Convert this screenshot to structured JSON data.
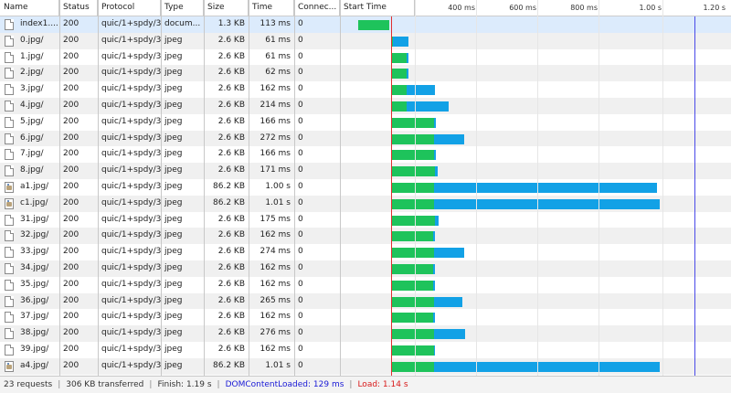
{
  "header": {
    "columns": [
      "Name",
      "Status",
      "Protocol",
      "Type",
      "Size",
      "Time",
      "Connec...",
      "Start Time"
    ],
    "ticks": [
      "400 ms",
      "600 ms",
      "800 ms",
      "1.00 s",
      "1.20 s"
    ]
  },
  "timeline": {
    "max_ms": 1200,
    "dom_content_loaded_ms": 0,
    "load_ms": 1140
  },
  "rows": [
    {
      "name": "index1....",
      "status": "200",
      "protocol": "quic/1+spdy/3",
      "type": "docum...",
      "size": "1.3 KB",
      "time": "113 ms",
      "connection": "0",
      "icon": "document",
      "waiting": [
        -126,
        -9
      ],
      "receiving": null
    },
    {
      "name": "0.jpg/",
      "status": "200",
      "protocol": "quic/1+spdy/3",
      "type": "jpeg",
      "size": "2.6 KB",
      "time": "61 ms",
      "connection": "0",
      "icon": "image-file",
      "waiting": [
        0,
        3
      ],
      "receiving": [
        3,
        61
      ]
    },
    {
      "name": "1.jpg/",
      "status": "200",
      "protocol": "quic/1+spdy/3",
      "type": "jpeg",
      "size": "2.6 KB",
      "time": "61 ms",
      "connection": "0",
      "icon": "image-file",
      "waiting": [
        0,
        56
      ],
      "receiving": [
        56,
        61
      ]
    },
    {
      "name": "2.jpg/",
      "status": "200",
      "protocol": "quic/1+spdy/3",
      "type": "jpeg",
      "size": "2.6 KB",
      "time": "62 ms",
      "connection": "0",
      "icon": "image-file",
      "waiting": [
        0,
        56
      ],
      "receiving": [
        56,
        62
      ]
    },
    {
      "name": "3.jpg/",
      "status": "200",
      "protocol": "quic/1+spdy/3",
      "type": "jpeg",
      "size": "2.6 KB",
      "time": "162 ms",
      "connection": "0",
      "icon": "image-file",
      "waiting": [
        0,
        56
      ],
      "receiving": [
        56,
        162
      ]
    },
    {
      "name": "4.jpg/",
      "status": "200",
      "protocol": "quic/1+spdy/3",
      "type": "jpeg",
      "size": "2.6 KB",
      "time": "214 ms",
      "connection": "0",
      "icon": "image-file",
      "waiting": [
        0,
        56
      ],
      "receiving": [
        56,
        214
      ]
    },
    {
      "name": "5.jpg/",
      "status": "200",
      "protocol": "quic/1+spdy/3",
      "type": "jpeg",
      "size": "2.6 KB",
      "time": "166 ms",
      "connection": "0",
      "icon": "image-file",
      "waiting": [
        0,
        160
      ],
      "receiving": [
        160,
        166
      ]
    },
    {
      "name": "6.jpg/",
      "status": "200",
      "protocol": "quic/1+spdy/3",
      "type": "jpeg",
      "size": "2.6 KB",
      "time": "272 ms",
      "connection": "0",
      "icon": "image-file",
      "waiting": [
        0,
        160
      ],
      "receiving": [
        160,
        272
      ]
    },
    {
      "name": "7.jpg/",
      "status": "200",
      "protocol": "quic/1+spdy/3",
      "type": "jpeg",
      "size": "2.6 KB",
      "time": "166 ms",
      "connection": "0",
      "icon": "image-file",
      "waiting": [
        0,
        160
      ],
      "receiving": [
        160,
        166
      ]
    },
    {
      "name": "8.jpg/",
      "status": "200",
      "protocol": "quic/1+spdy/3",
      "type": "jpeg",
      "size": "2.6 KB",
      "time": "171 ms",
      "connection": "0",
      "icon": "image-file",
      "waiting": [
        0,
        163
      ],
      "receiving": [
        163,
        171
      ]
    },
    {
      "name": "a1.jpg/",
      "status": "200",
      "protocol": "quic/1+spdy/3",
      "type": "jpeg",
      "size": "86.2 KB",
      "time": "1.00 s",
      "connection": "0",
      "icon": "image-photo",
      "waiting": [
        0,
        160
      ],
      "receiving": [
        160,
        1000
      ]
    },
    {
      "name": "c1.jpg/",
      "status": "200",
      "protocol": "quic/1+spdy/3",
      "type": "jpeg",
      "size": "86.2 KB",
      "time": "1.01 s",
      "connection": "0",
      "icon": "image-photo",
      "waiting": [
        0,
        160
      ],
      "receiving": [
        160,
        1010
      ]
    },
    {
      "name": "31.jpg/",
      "status": "200",
      "protocol": "quic/1+spdy/3",
      "type": "jpeg",
      "size": "2.6 KB",
      "time": "175 ms",
      "connection": "0",
      "icon": "image-file",
      "waiting": [
        0,
        163
      ],
      "receiving": [
        163,
        175
      ]
    },
    {
      "name": "32.jpg/",
      "status": "200",
      "protocol": "quic/1+spdy/3",
      "type": "jpeg",
      "size": "2.6 KB",
      "time": "162 ms",
      "connection": "0",
      "icon": "image-file",
      "waiting": [
        0,
        156
      ],
      "receiving": [
        156,
        162
      ]
    },
    {
      "name": "33.jpg/",
      "status": "200",
      "protocol": "quic/1+spdy/3",
      "type": "jpeg",
      "size": "2.6 KB",
      "time": "274 ms",
      "connection": "0",
      "icon": "image-file",
      "waiting": [
        0,
        160
      ],
      "receiving": [
        160,
        274
      ]
    },
    {
      "name": "34.jpg/",
      "status": "200",
      "protocol": "quic/1+spdy/3",
      "type": "jpeg",
      "size": "2.6 KB",
      "time": "162 ms",
      "connection": "0",
      "icon": "image-file",
      "waiting": [
        0,
        156
      ],
      "receiving": [
        156,
        162
      ]
    },
    {
      "name": "35.jpg/",
      "status": "200",
      "protocol": "quic/1+spdy/3",
      "type": "jpeg",
      "size": "2.6 KB",
      "time": "162 ms",
      "connection": "0",
      "icon": "image-file",
      "waiting": [
        0,
        156
      ],
      "receiving": [
        156,
        162
      ]
    },
    {
      "name": "36.jpg/",
      "status": "200",
      "protocol": "quic/1+spdy/3",
      "type": "jpeg",
      "size": "2.6 KB",
      "time": "265 ms",
      "connection": "0",
      "icon": "image-file",
      "waiting": [
        0,
        160
      ],
      "receiving": [
        160,
        265
      ]
    },
    {
      "name": "37.jpg/",
      "status": "200",
      "protocol": "quic/1+spdy/3",
      "type": "jpeg",
      "size": "2.6 KB",
      "time": "162 ms",
      "connection": "0",
      "icon": "image-file",
      "waiting": [
        0,
        156
      ],
      "receiving": [
        156,
        162
      ]
    },
    {
      "name": "38.jpg/",
      "status": "200",
      "protocol": "quic/1+spdy/3",
      "type": "jpeg",
      "size": "2.6 KB",
      "time": "276 ms",
      "connection": "0",
      "icon": "image-file",
      "waiting": [
        0,
        160
      ],
      "receiving": [
        160,
        276
      ]
    },
    {
      "name": "39.jpg/",
      "status": "200",
      "protocol": "quic/1+spdy/3",
      "type": "jpeg",
      "size": "2.6 KB",
      "time": "162 ms",
      "connection": "0",
      "icon": "image-file",
      "waiting": [
        0,
        160
      ],
      "receiving": [
        160,
        162
      ]
    },
    {
      "name": "a4.jpg/",
      "status": "200",
      "protocol": "quic/1+spdy/3",
      "type": "jpeg",
      "size": "86.2 KB",
      "time": "1.01 s",
      "connection": "0",
      "icon": "image-photo",
      "waiting": [
        0,
        160
      ],
      "receiving": [
        160,
        1012
      ]
    }
  ],
  "footer": {
    "requests": "23 requests",
    "transferred": "306 KB transferred",
    "finish": "Finish: 1.19 s",
    "dcl": "DOMContentLoaded: 129 ms",
    "load": "Load: 1.14 s"
  },
  "colors": {
    "waiting": "#1ec35b",
    "receiving": "#12a1e6",
    "dcl_marker": "#4a4ae8",
    "load_marker": "#e03030",
    "selected_row": "#dcebfc",
    "alt_row": "#f0f0f0"
  }
}
